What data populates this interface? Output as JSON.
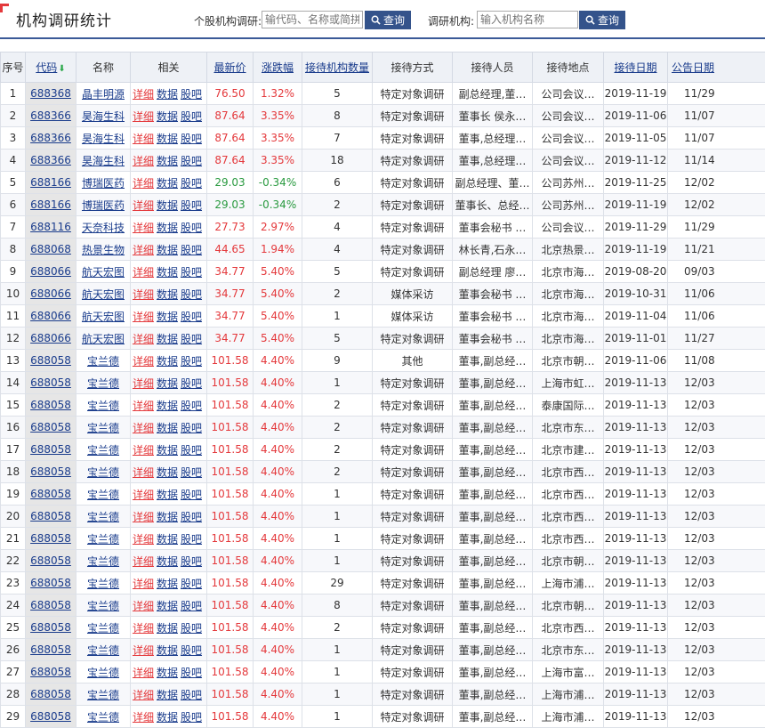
{
  "header": {
    "title": "机构调研统计",
    "stock_search_label": "个股机构调研:",
    "stock_search_placeholder": "输代码、名称或简拼",
    "stock_search_button": "查询",
    "org_search_label": "调研机构:",
    "org_search_placeholder": "输入机构名称",
    "org_search_button": "查询"
  },
  "colors": {
    "accent": "#34538b",
    "up": "#e4393c",
    "down": "#2a9a40",
    "link": "#1a3c8c"
  },
  "table": {
    "columns": [
      "序号",
      "代码",
      "名称",
      "相关",
      "最新价",
      "涨跌幅",
      "接待机构数量",
      "接待方式",
      "接待人员",
      "接待地点",
      "接待日期",
      "公告日期"
    ],
    "related_links": [
      "详细",
      "数据",
      "股吧"
    ],
    "rows": [
      {
        "no": "1",
        "code": "688368",
        "name": "晶丰明源",
        "price": "76.50",
        "change": "1.32%",
        "dir": "up",
        "orgs": "5",
        "method": "特定对象调研",
        "people": "副总经理,董…",
        "place": "公司会议…",
        "date": "2019-11-19",
        "notice": "11/29"
      },
      {
        "no": "2",
        "code": "688366",
        "name": "昊海生科",
        "price": "87.64",
        "change": "3.35%",
        "dir": "up",
        "orgs": "8",
        "method": "特定对象调研",
        "people": "董事长 侯永…",
        "place": "公司会议…",
        "date": "2019-11-06",
        "notice": "11/07"
      },
      {
        "no": "3",
        "code": "688366",
        "name": "昊海生科",
        "price": "87.64",
        "change": "3.35%",
        "dir": "up",
        "orgs": "7",
        "method": "特定对象调研",
        "people": "董事,总经理…",
        "place": "公司会议…",
        "date": "2019-11-05",
        "notice": "11/07"
      },
      {
        "no": "4",
        "code": "688366",
        "name": "昊海生科",
        "price": "87.64",
        "change": "3.35%",
        "dir": "up",
        "orgs": "18",
        "method": "特定对象调研",
        "people": "董事,总经理…",
        "place": "公司会议…",
        "date": "2019-11-12",
        "notice": "11/14"
      },
      {
        "no": "5",
        "code": "688166",
        "name": "博瑞医药",
        "price": "29.03",
        "change": "-0.34%",
        "dir": "down",
        "orgs": "6",
        "method": "特定对象调研",
        "people": "副总经理、董…",
        "place": "公司苏州…",
        "date": "2019-11-25",
        "notice": "12/02"
      },
      {
        "no": "6",
        "code": "688166",
        "name": "博瑞医药",
        "price": "29.03",
        "change": "-0.34%",
        "dir": "down",
        "orgs": "2",
        "method": "特定对象调研",
        "people": "董事长、总经…",
        "place": "公司苏州…",
        "date": "2019-11-19",
        "notice": "12/02"
      },
      {
        "no": "7",
        "code": "688116",
        "name": "天奈科技",
        "price": "27.73",
        "change": "2.97%",
        "dir": "up",
        "orgs": "4",
        "method": "特定对象调研",
        "people": "董事会秘书 …",
        "place": "公司会议…",
        "date": "2019-11-29",
        "notice": "11/29"
      },
      {
        "no": "8",
        "code": "688068",
        "name": "热景生物",
        "price": "44.65",
        "change": "1.94%",
        "dir": "up",
        "orgs": "4",
        "method": "特定对象调研",
        "people": "林长青,石永…",
        "place": "北京热景…",
        "date": "2019-11-19",
        "notice": "11/21"
      },
      {
        "no": "9",
        "code": "688066",
        "name": "航天宏图",
        "price": "34.77",
        "change": "5.40%",
        "dir": "up",
        "orgs": "5",
        "method": "特定对象调研",
        "people": "副总经理 廖…",
        "place": "北京市海…",
        "date": "2019-08-20",
        "notice": "09/03"
      },
      {
        "no": "10",
        "code": "688066",
        "name": "航天宏图",
        "price": "34.77",
        "change": "5.40%",
        "dir": "up",
        "orgs": "2",
        "method": "媒体采访",
        "people": "董事会秘书 …",
        "place": "北京市海…",
        "date": "2019-10-31",
        "notice": "11/06"
      },
      {
        "no": "11",
        "code": "688066",
        "name": "航天宏图",
        "price": "34.77",
        "change": "5.40%",
        "dir": "up",
        "orgs": "1",
        "method": "媒体采访",
        "people": "董事会秘书 …",
        "place": "北京市海…",
        "date": "2019-11-04",
        "notice": "11/06"
      },
      {
        "no": "12",
        "code": "688066",
        "name": "航天宏图",
        "price": "34.77",
        "change": "5.40%",
        "dir": "up",
        "orgs": "5",
        "method": "特定对象调研",
        "people": "董事会秘书 …",
        "place": "北京市海…",
        "date": "2019-11-01",
        "notice": "11/27"
      },
      {
        "no": "13",
        "code": "688058",
        "name": "宝兰德",
        "price": "101.58",
        "change": "4.40%",
        "dir": "up",
        "orgs": "9",
        "method": "其他",
        "people": "董事,副总经…",
        "place": "北京市朝…",
        "date": "2019-11-06",
        "notice": "11/08"
      },
      {
        "no": "14",
        "code": "688058",
        "name": "宝兰德",
        "price": "101.58",
        "change": "4.40%",
        "dir": "up",
        "orgs": "1",
        "method": "特定对象调研",
        "people": "董事,副总经…",
        "place": "上海市虹…",
        "date": "2019-11-13",
        "notice": "12/03"
      },
      {
        "no": "15",
        "code": "688058",
        "name": "宝兰德",
        "price": "101.58",
        "change": "4.40%",
        "dir": "up",
        "orgs": "2",
        "method": "特定对象调研",
        "people": "董事,副总经…",
        "place": "泰康国际…",
        "date": "2019-11-13",
        "notice": "12/03"
      },
      {
        "no": "16",
        "code": "688058",
        "name": "宝兰德",
        "price": "101.58",
        "change": "4.40%",
        "dir": "up",
        "orgs": "2",
        "method": "特定对象调研",
        "people": "董事,副总经…",
        "place": "北京市东…",
        "date": "2019-11-13",
        "notice": "12/03"
      },
      {
        "no": "17",
        "code": "688058",
        "name": "宝兰德",
        "price": "101.58",
        "change": "4.40%",
        "dir": "up",
        "orgs": "2",
        "method": "特定对象调研",
        "people": "董事,副总经…",
        "place": "北京市建…",
        "date": "2019-11-13",
        "notice": "12/03"
      },
      {
        "no": "18",
        "code": "688058",
        "name": "宝兰德",
        "price": "101.58",
        "change": "4.40%",
        "dir": "up",
        "orgs": "2",
        "method": "特定对象调研",
        "people": "董事,副总经…",
        "place": "北京市西…",
        "date": "2019-11-13",
        "notice": "12/03"
      },
      {
        "no": "19",
        "code": "688058",
        "name": "宝兰德",
        "price": "101.58",
        "change": "4.40%",
        "dir": "up",
        "orgs": "1",
        "method": "特定对象调研",
        "people": "董事,副总经…",
        "place": "北京市西…",
        "date": "2019-11-13",
        "notice": "12/03"
      },
      {
        "no": "20",
        "code": "688058",
        "name": "宝兰德",
        "price": "101.58",
        "change": "4.40%",
        "dir": "up",
        "orgs": "1",
        "method": "特定对象调研",
        "people": "董事,副总经…",
        "place": "北京市西…",
        "date": "2019-11-13",
        "notice": "12/03"
      },
      {
        "no": "21",
        "code": "688058",
        "name": "宝兰德",
        "price": "101.58",
        "change": "4.40%",
        "dir": "up",
        "orgs": "1",
        "method": "特定对象调研",
        "people": "董事,副总经…",
        "place": "北京市西…",
        "date": "2019-11-13",
        "notice": "12/03"
      },
      {
        "no": "22",
        "code": "688058",
        "name": "宝兰德",
        "price": "101.58",
        "change": "4.40%",
        "dir": "up",
        "orgs": "1",
        "method": "特定对象调研",
        "people": "董事,副总经…",
        "place": "北京市朝…",
        "date": "2019-11-13",
        "notice": "12/03"
      },
      {
        "no": "23",
        "code": "688058",
        "name": "宝兰德",
        "price": "101.58",
        "change": "4.40%",
        "dir": "up",
        "orgs": "29",
        "method": "特定对象调研",
        "people": "董事,副总经…",
        "place": "上海市浦…",
        "date": "2019-11-13",
        "notice": "12/03"
      },
      {
        "no": "24",
        "code": "688058",
        "name": "宝兰德",
        "price": "101.58",
        "change": "4.40%",
        "dir": "up",
        "orgs": "8",
        "method": "特定对象调研",
        "people": "董事,副总经…",
        "place": "北京市朝…",
        "date": "2019-11-13",
        "notice": "12/03"
      },
      {
        "no": "25",
        "code": "688058",
        "name": "宝兰德",
        "price": "101.58",
        "change": "4.40%",
        "dir": "up",
        "orgs": "2",
        "method": "特定对象调研",
        "people": "董事,副总经…",
        "place": "北京市西…",
        "date": "2019-11-13",
        "notice": "12/03"
      },
      {
        "no": "26",
        "code": "688058",
        "name": "宝兰德",
        "price": "101.58",
        "change": "4.40%",
        "dir": "up",
        "orgs": "1",
        "method": "特定对象调研",
        "people": "董事,副总经…",
        "place": "北京市东…",
        "date": "2019-11-13",
        "notice": "12/03"
      },
      {
        "no": "27",
        "code": "688058",
        "name": "宝兰德",
        "price": "101.58",
        "change": "4.40%",
        "dir": "up",
        "orgs": "1",
        "method": "特定对象调研",
        "people": "董事,副总经…",
        "place": "上海市富…",
        "date": "2019-11-13",
        "notice": "12/03"
      },
      {
        "no": "28",
        "code": "688058",
        "name": "宝兰德",
        "price": "101.58",
        "change": "4.40%",
        "dir": "up",
        "orgs": "1",
        "method": "特定对象调研",
        "people": "董事,副总经…",
        "place": "上海市浦…",
        "date": "2019-11-13",
        "notice": "12/03"
      },
      {
        "no": "29",
        "code": "688058",
        "name": "宝兰德",
        "price": "101.58",
        "change": "4.40%",
        "dir": "up",
        "orgs": "1",
        "method": "特定对象调研",
        "people": "董事,副总经…",
        "place": "上海市浦…",
        "date": "2019-11-13",
        "notice": "12/03"
      }
    ]
  }
}
